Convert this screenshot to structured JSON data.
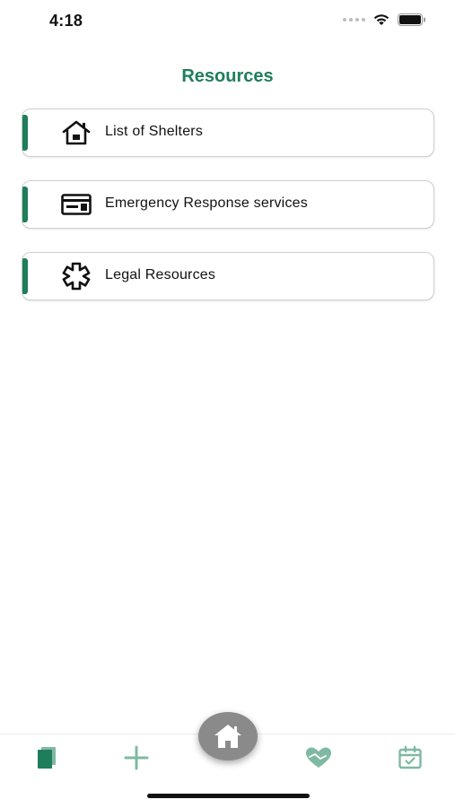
{
  "status_bar": {
    "time": "4:18"
  },
  "header": {
    "title": "Resources"
  },
  "colors": {
    "accent": "#1e7e5a",
    "tab_icon": "#7fb9a3",
    "fab": "#8a8a8a"
  },
  "resources": [
    {
      "label": "List of Shelters",
      "icon": "house-icon"
    },
    {
      "label": "Emergency Response services",
      "icon": "id-card-icon"
    },
    {
      "label": "Legal Resources",
      "icon": "asterisk-icon"
    }
  ],
  "tab_bar": {
    "tabs": [
      {
        "name": "journal",
        "icon": "book-icon"
      },
      {
        "name": "add",
        "icon": "plus-icon"
      },
      {
        "name": "home",
        "icon": "home-icon"
      },
      {
        "name": "support",
        "icon": "heart-hands-icon"
      },
      {
        "name": "calendar",
        "icon": "calendar-check-icon"
      }
    ]
  }
}
